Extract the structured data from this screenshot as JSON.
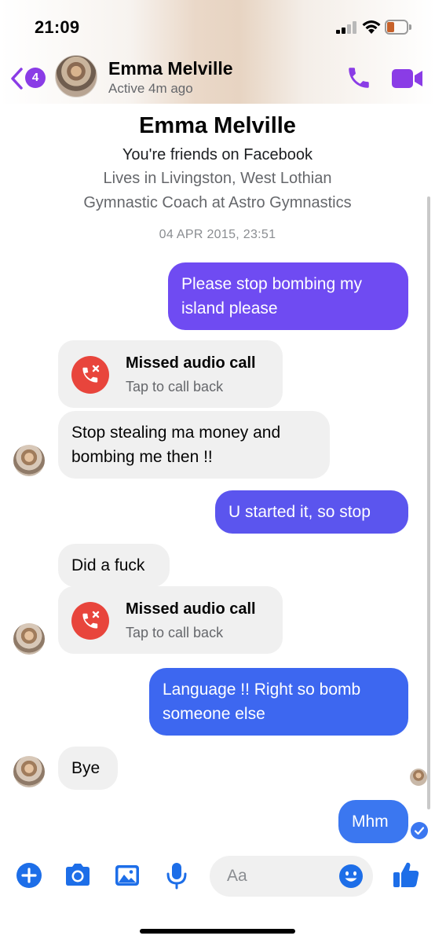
{
  "status_bar": {
    "time": "21:09"
  },
  "header": {
    "back_badge": "4",
    "contact_name": "Emma Melville",
    "contact_status": "Active 4m ago",
    "icons": [
      "back-chevron-icon",
      "avatar",
      "phone-icon",
      "video-camera-icon"
    ]
  },
  "intro": {
    "name": "Emma Melville",
    "line1": "You're friends on Facebook",
    "line2": "Lives in Livingston, West Lothian",
    "line3": "Gymnastic Coach at Astro Gymnastics"
  },
  "timestamp": "04 APR 2015, 23:51",
  "messages": [
    {
      "from": "me",
      "text": "Please stop bombing my island please"
    },
    {
      "from": "them",
      "type": "call",
      "title": "Missed audio call",
      "subtitle": "Tap to call back"
    },
    {
      "from": "them",
      "text": "Stop stealing ma money and bombing me then !!"
    },
    {
      "from": "me",
      "text": "U started it, so stop"
    },
    {
      "from": "them",
      "text": "Did a fuck"
    },
    {
      "from": "them",
      "type": "call",
      "title": "Missed audio call",
      "subtitle": "Tap to call back"
    },
    {
      "from": "me",
      "text": "Language !! Right so bomb someone else"
    },
    {
      "from": "them",
      "text": "Bye"
    },
    {
      "from": "me",
      "text": "Mhm"
    }
  ],
  "composer": {
    "placeholder": "Aa",
    "icons": [
      "plus-icon",
      "camera-icon",
      "photo-icon",
      "microphone-icon",
      "emoji-icon",
      "thumbs-up-icon"
    ]
  },
  "colors": {
    "accent_purple": "#7a3ef0",
    "bubble_purple": "#6f4bf2",
    "bubble_indigo": "#5b55ee",
    "bubble_blue": "#3b6ef0",
    "incoming_bg": "#f0f0f0",
    "missed_call_red": "#e8453c",
    "composer_blue": "#1d6ee8"
  }
}
